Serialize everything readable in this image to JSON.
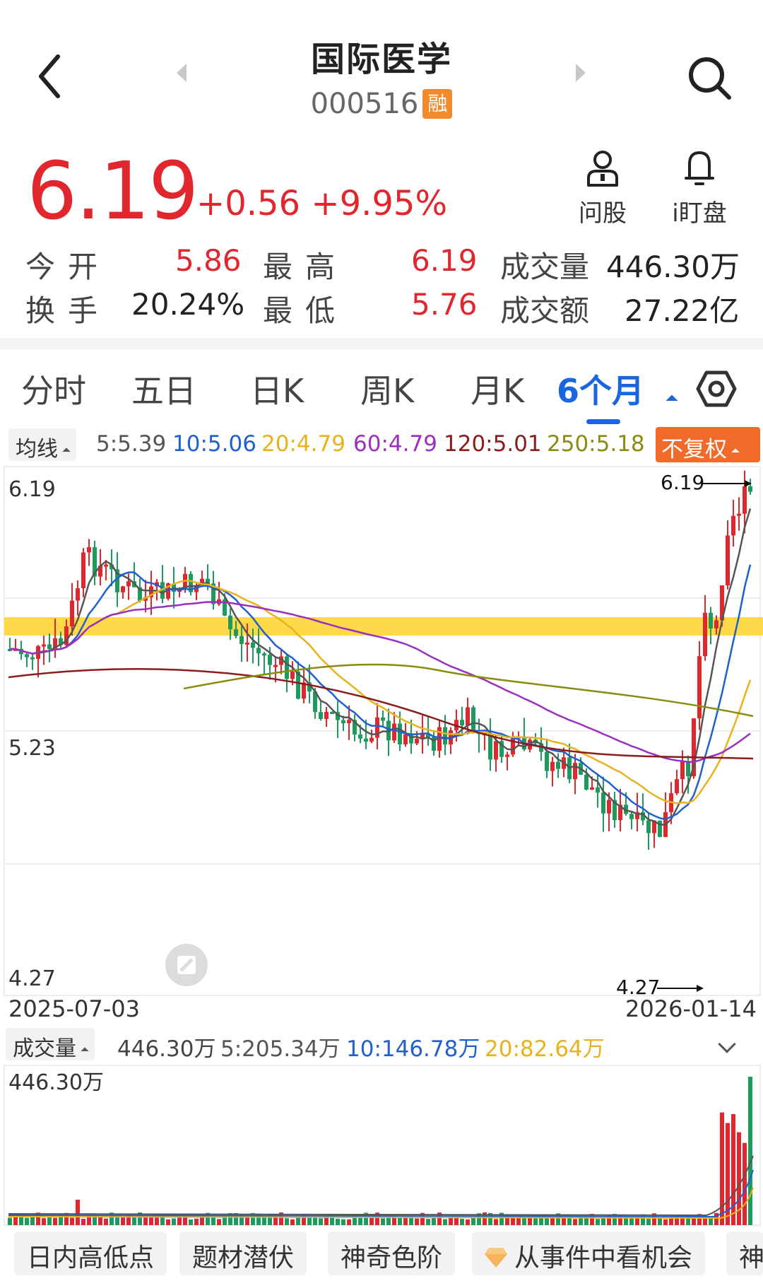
{
  "header": {
    "title": "国际医学",
    "code": "000516",
    "badge": "融"
  },
  "quote": {
    "price": "6.19",
    "change": "+0.56",
    "change_pct": "+9.95%"
  },
  "actions": {
    "ask_label": "问股",
    "watch_label": "i盯盘"
  },
  "stats": {
    "open_label": "今开",
    "open": "5.86",
    "high_label": "最高",
    "high": "6.19",
    "volume_label": "成交量",
    "volume": "446.30万",
    "turnover_label": "换手",
    "turnover": "20.24%",
    "low_label": "最低",
    "low": "5.76",
    "amount_label": "成交额",
    "amount": "27.22亿"
  },
  "tabs": [
    "分时",
    "五日",
    "日K",
    "周K",
    "月K",
    "6个月"
  ],
  "active_tab": "6个月",
  "ma": {
    "chip": "均线",
    "items": [
      {
        "text": "5:5.39",
        "color": "#555555"
      },
      {
        "text": "10:5.06",
        "color": "#1f5fd0"
      },
      {
        "text": "20:4.79",
        "color": "#e8b21c"
      },
      {
        "text": "60:4.79",
        "color": "#9b2fc0"
      },
      {
        "text": "120:5.01",
        "color": "#8a1c1c"
      },
      {
        "text": "250:5.18",
        "color": "#8b8b12"
      }
    ],
    "adjust": "不复权"
  },
  "chart": {
    "y_top": "6.19",
    "y_mid": "5.23",
    "y_bottom": "4.27",
    "max_label": "6.19",
    "min_label": "4.27",
    "date_start": "2025-07-03",
    "date_end": "2026-01-14"
  },
  "volume": {
    "chip": "成交量",
    "total": "446.30万",
    "ma5": "5:205.34万",
    "ma10": "10:146.78万",
    "ma20": "20:82.64万",
    "y_top": "446.30万"
  },
  "features": [
    "日内高低点",
    "题材潜伏",
    "神奇色阶",
    "从事件中看机会",
    "神"
  ],
  "colors": {
    "up": "#e2262e",
    "down": "#1c9c5c",
    "accent": "#1a66e0",
    "highlight_band": "#ffd94a"
  }
}
